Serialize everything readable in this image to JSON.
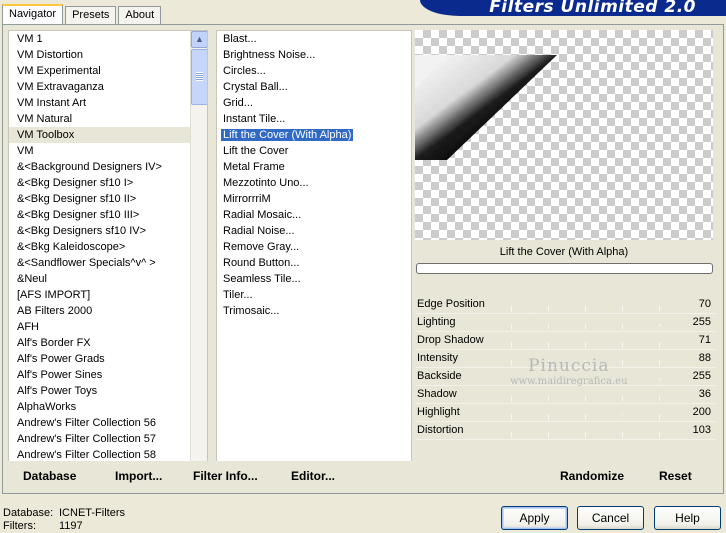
{
  "banner": {
    "title": "Filters Unlimited 2.0"
  },
  "tabs": [
    {
      "label": "Navigator",
      "active": true
    },
    {
      "label": "Presets",
      "active": false
    },
    {
      "label": "About",
      "active": false
    }
  ],
  "categories": {
    "items": [
      "VM 1",
      "VM Distortion",
      "VM Experimental",
      "VM Extravaganza",
      "VM Instant Art",
      "VM Natural",
      "VM Toolbox",
      "VM",
      "&<Background Designers IV>",
      "&<Bkg Designer sf10 I>",
      "&<Bkg Designer sf10 II>",
      "&<Bkg Designer sf10 III>",
      "&<Bkg Designers sf10 IV>",
      "&<Bkg Kaleidoscope>",
      "&<Sandflower Specials^v^ >",
      "&Neul",
      "[AFS IMPORT]",
      "AB Filters 2000",
      "AFH",
      "Alf's Border FX",
      "Alf's Power Grads",
      "Alf's Power Sines",
      "Alf's Power Toys",
      "AlphaWorks",
      "Andrew's Filter Collection 56",
      "Andrew's Filter Collection 57",
      "Andrew's Filter Collection 58"
    ],
    "selected_index": 6
  },
  "filters": {
    "items": [
      "Blast...",
      "Brightness Noise...",
      "Circles...",
      "Crystal Ball...",
      "Grid...",
      "Instant Tile...",
      "Lift the Cover (With Alpha)",
      "Lift the Cover",
      "Metal Frame",
      "Mezzotinto Uno...",
      "MirrorrriM",
      "Radial Mosaic...",
      "Radial Noise...",
      "Remove Gray...",
      "Round Button...",
      "Seamless Tile...",
      "Tiler...",
      "Trimosaic..."
    ],
    "selected_index": 6
  },
  "preview": {
    "title": "Lift the Cover (With Alpha)"
  },
  "params": [
    {
      "name": "Edge Position",
      "value": "70"
    },
    {
      "name": "Lighting",
      "value": "255"
    },
    {
      "name": "Drop Shadow",
      "value": "71"
    },
    {
      "name": "Intensity",
      "value": "88"
    },
    {
      "name": "Backside",
      "value": "255"
    },
    {
      "name": "Shadow",
      "value": "36"
    },
    {
      "name": "Highlight",
      "value": "200"
    },
    {
      "name": "Distortion",
      "value": "103"
    }
  ],
  "watermark": {
    "line1": "Pinuccia",
    "line2": "www.maidiregrafica.eu"
  },
  "toolbar": {
    "database": "Database",
    "import": "Import...",
    "filter_info": "Filter Info...",
    "editor": "Editor...",
    "randomize": "Randomize",
    "reset": "Reset"
  },
  "footer": {
    "database_label": "Database:",
    "database_value": "ICNET-Filters",
    "filters_label": "Filters:",
    "filters_value": "1197"
  },
  "buttons": {
    "apply": "Apply",
    "cancel": "Cancel",
    "help": "Help"
  },
  "colors": {
    "selection": "#316ac5",
    "banner": "#0a2a8e",
    "background": "#ece9d8"
  }
}
